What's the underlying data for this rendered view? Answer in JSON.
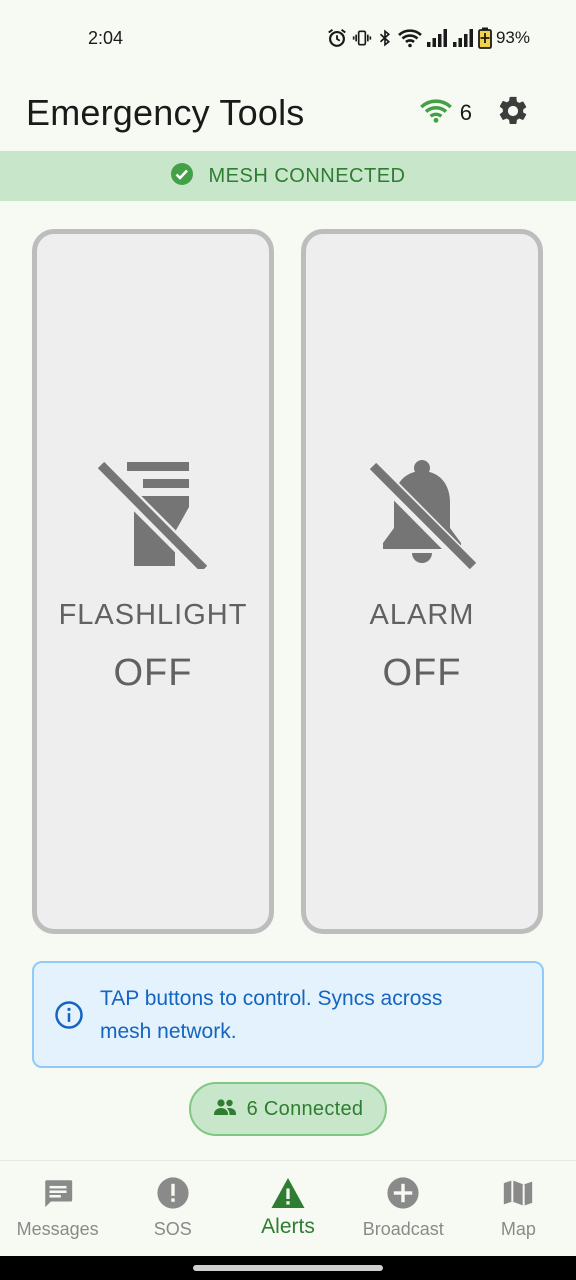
{
  "status_bar": {
    "time": "2:04",
    "battery": "93%",
    "icons": [
      "alarm-icon",
      "vibrate-icon",
      "bluetooth-icon",
      "wifi-icon",
      "signal-icon",
      "signal-icon",
      "battery-icon"
    ]
  },
  "app_bar": {
    "title": "Emergency Tools",
    "peer_count": "6",
    "wifi_color": "#43a047"
  },
  "mesh_banner": {
    "label": "MESH CONNECTED",
    "color": "#2e7d32",
    "background": "#c8e6c9"
  },
  "tools": [
    {
      "label": "FLASHLIGHT",
      "state": "OFF",
      "icon": "flashlight-off-icon"
    },
    {
      "label": "ALARM",
      "state": "OFF",
      "icon": "bell-off-icon"
    }
  ],
  "info": {
    "line1": "TAP buttons to control. Syncs across",
    "line2": "mesh network.",
    "color": "#1565c0"
  },
  "connected_chip": {
    "label": "6 Connected"
  },
  "nav": {
    "items": [
      {
        "label": "Messages",
        "icon": "message-icon",
        "active": false
      },
      {
        "label": "SOS",
        "icon": "alert-circle-icon",
        "active": false
      },
      {
        "label": "Alerts",
        "icon": "warning-triangle-icon",
        "active": true
      },
      {
        "label": "Broadcast",
        "icon": "add-circle-icon",
        "active": false
      },
      {
        "label": "Map",
        "icon": "map-icon",
        "active": false
      }
    ],
    "active_color": "#2e7d32",
    "inactive_color": "#8a8a8a"
  }
}
